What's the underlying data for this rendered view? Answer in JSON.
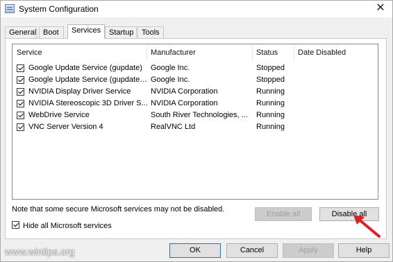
{
  "window": {
    "title": "System Configuration",
    "close_glyph": "✕"
  },
  "tabs": [
    {
      "label": "General",
      "active": false
    },
    {
      "label": "Boot",
      "active": false
    },
    {
      "label": "Services",
      "active": true
    },
    {
      "label": "Startup",
      "active": false
    },
    {
      "label": "Tools",
      "active": false
    }
  ],
  "columns": [
    "Service",
    "Manufacturer",
    "Status",
    "Date Disabled"
  ],
  "services": [
    {
      "name": "Google Update Service (gupdate)",
      "manufacturer": "Google Inc.",
      "status": "Stopped",
      "date_disabled": "",
      "checked": true
    },
    {
      "name": "Google Update Service (gupdatem)",
      "manufacturer": "Google Inc.",
      "status": "Stopped",
      "date_disabled": "",
      "checked": true
    },
    {
      "name": "NVIDIA Display Driver Service",
      "manufacturer": "NVIDIA Corporation",
      "status": "Running",
      "date_disabled": "",
      "checked": true
    },
    {
      "name": "NVIDIA Stereoscopic 3D Driver S...",
      "manufacturer": "NVIDIA Corporation",
      "status": "Running",
      "date_disabled": "",
      "checked": true
    },
    {
      "name": "WebDrive Service",
      "manufacturer": "South River Technologies, ...",
      "status": "Running",
      "date_disabled": "",
      "checked": true
    },
    {
      "name": "VNC Server Version 4",
      "manufacturer": "RealVNC Ltd",
      "status": "Running",
      "date_disabled": "",
      "checked": true
    }
  ],
  "note": "Note that some secure Microsoft services may not be disabled.",
  "buttons": {
    "enable_all": "Enable all",
    "disable_all": "Disable all",
    "ok": "OK",
    "cancel": "Cancel",
    "apply": "Apply",
    "help": "Help"
  },
  "hide_ms": {
    "label": "Hide all Microsoft services",
    "checked": true
  },
  "watermark": "www.wintips.org",
  "colors": {
    "arrow": "#e01e25",
    "default_border": "#0078d7"
  }
}
